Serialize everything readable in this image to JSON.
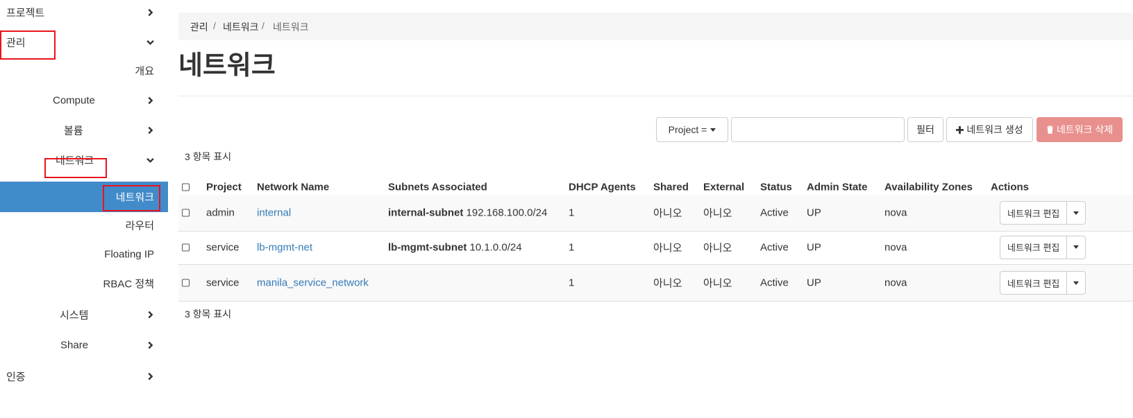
{
  "sidebar": {
    "items": [
      {
        "label": "프로젝트",
        "chevron": "right"
      },
      {
        "label": "관리",
        "chevron": "down"
      },
      {
        "label": "개요",
        "chevron": null
      },
      {
        "label": "Compute",
        "chevron": "right"
      },
      {
        "label": "볼륨",
        "chevron": "right"
      },
      {
        "label": "네트워크",
        "chevron": "down"
      },
      {
        "label": "네트워크",
        "chevron": null,
        "active": true
      },
      {
        "label": "라우터",
        "chevron": null
      },
      {
        "label": "Floating IP",
        "chevron": null
      },
      {
        "label": "RBAC 정책",
        "chevron": null
      },
      {
        "label": "시스템",
        "chevron": "right"
      },
      {
        "label": "Share",
        "chevron": "right"
      },
      {
        "label": "인증",
        "chevron": "right"
      }
    ]
  },
  "breadcrumb": {
    "items": [
      "관리",
      "네트워크",
      "네트워크"
    ],
    "separator": "/"
  },
  "page": {
    "title": "네트워크"
  },
  "toolbar": {
    "filter_dropdown_label": "Project =",
    "search_value": "",
    "filter_button": "필터",
    "create_button": "네트워크 생성",
    "delete_button": "네트워크 삭제"
  },
  "table": {
    "count_top": "3 항목 표시",
    "count_bottom": "3 항목 표시",
    "headers": [
      "Project",
      "Network Name",
      "Subnets Associated",
      "DHCP Agents",
      "Shared",
      "External",
      "Status",
      "Admin State",
      "Availability Zones",
      "Actions"
    ],
    "rows": [
      {
        "project": "admin",
        "name": "internal",
        "subnet_name": "internal-subnet",
        "subnet_cidr": "192.168.100.0/24",
        "dhcp": "1",
        "shared": "아니오",
        "external": "아니오",
        "status": "Active",
        "admin_state": "UP",
        "az": "nova",
        "action": "네트워크 편집"
      },
      {
        "project": "service",
        "name": "lb-mgmt-net",
        "subnet_name": "lb-mgmt-subnet",
        "subnet_cidr": "10.1.0.0/24",
        "dhcp": "1",
        "shared": "아니오",
        "external": "아니오",
        "status": "Active",
        "admin_state": "UP",
        "az": "nova",
        "action": "네트워크 편집"
      },
      {
        "project": "service",
        "name": "manila_service_network",
        "subnet_name": "",
        "subnet_cidr": "",
        "dhcp": "1",
        "shared": "아니오",
        "external": "아니오",
        "status": "Active",
        "admin_state": "UP",
        "az": "nova",
        "action": "네트워크 편집"
      }
    ]
  },
  "colors": {
    "active_nav_bg": "#428bca",
    "link": "#337ab7",
    "danger_button": "#e8908e",
    "highlight_box": "#e8131b"
  }
}
